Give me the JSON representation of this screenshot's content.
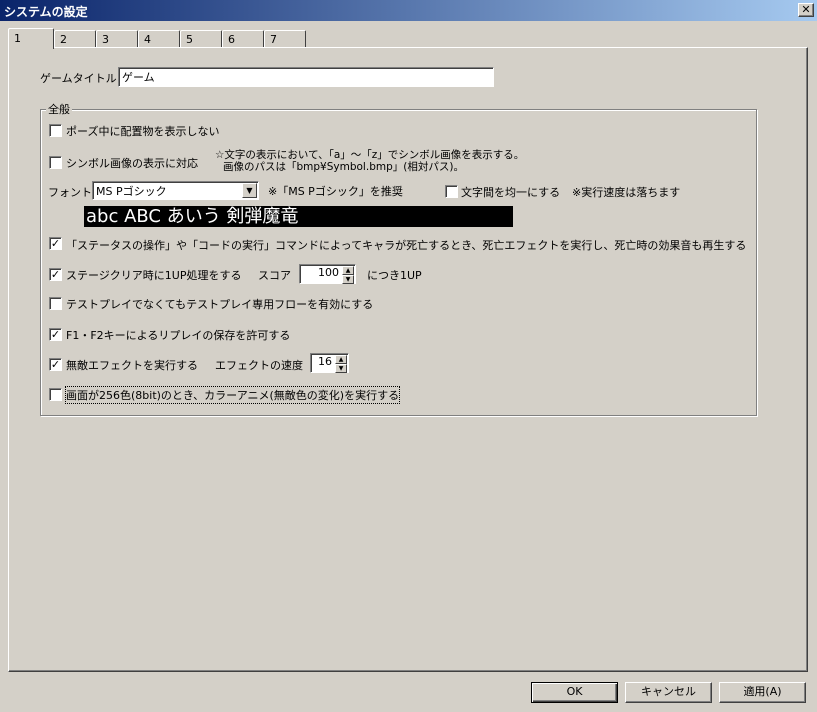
{
  "window": {
    "title": "システムの設定",
    "close_glyph": "✕"
  },
  "tabs": [
    "1",
    "2",
    "3",
    "4",
    "5",
    "6",
    "7"
  ],
  "game_title": {
    "label": "ゲームタイトル",
    "value": "ゲーム"
  },
  "general": {
    "title": "全般",
    "pause_hide": {
      "label": "ポーズ中に配置物を表示しない",
      "checked": false
    },
    "symbol_support": {
      "label": "シンボル画像の表示に対応",
      "checked": false,
      "note_line1": "☆文字の表示において、「a」～「z」でシンボル画像を表示する。",
      "note_line2": "画像のパスは「bmp¥Symbol.bmp」(相対パス)。"
    },
    "font": {
      "label": "フォント",
      "selected": "MS Pゴシック",
      "hint": "※「MS Pゴシック」を推奨",
      "equal_spacing_label": "文字間を均一にする",
      "equal_spacing_checked": false,
      "speed_note": "※実行速度は落ちます",
      "preview_text": "abc ABC あいう 剣弾魔竜"
    },
    "death_effect": {
      "label": "「ステータスの操作」や「コードの実行」コマンドによってキャラが死亡するとき、死亡エフェクトを実行し、死亡時の効果音も再生する",
      "checked": true
    },
    "stage_clear": {
      "label": "ステージクリア時に1UP処理をする",
      "checked": true,
      "score_label": "スコア",
      "score_value": "100",
      "score_suffix": "につき1UP"
    },
    "testplay_flow": {
      "label": "テストプレイでなくてもテストプレイ専用フローを有効にする",
      "checked": false
    },
    "replay_save": {
      "label": "F1・F2キーによるリプレイの保存を許可する",
      "checked": true
    },
    "invincible_effect": {
      "label": "無敵エフェクトを実行する",
      "checked": true,
      "speed_label": "エフェクトの速度",
      "speed_value": "16"
    },
    "color_anime": {
      "label": "画面が256色(8bit)のとき、カラーアニメ(無敵色の変化)を実行する",
      "checked": false
    }
  },
  "buttons": {
    "ok": "OK",
    "cancel": "キャンセル",
    "apply": "適用(A)"
  }
}
